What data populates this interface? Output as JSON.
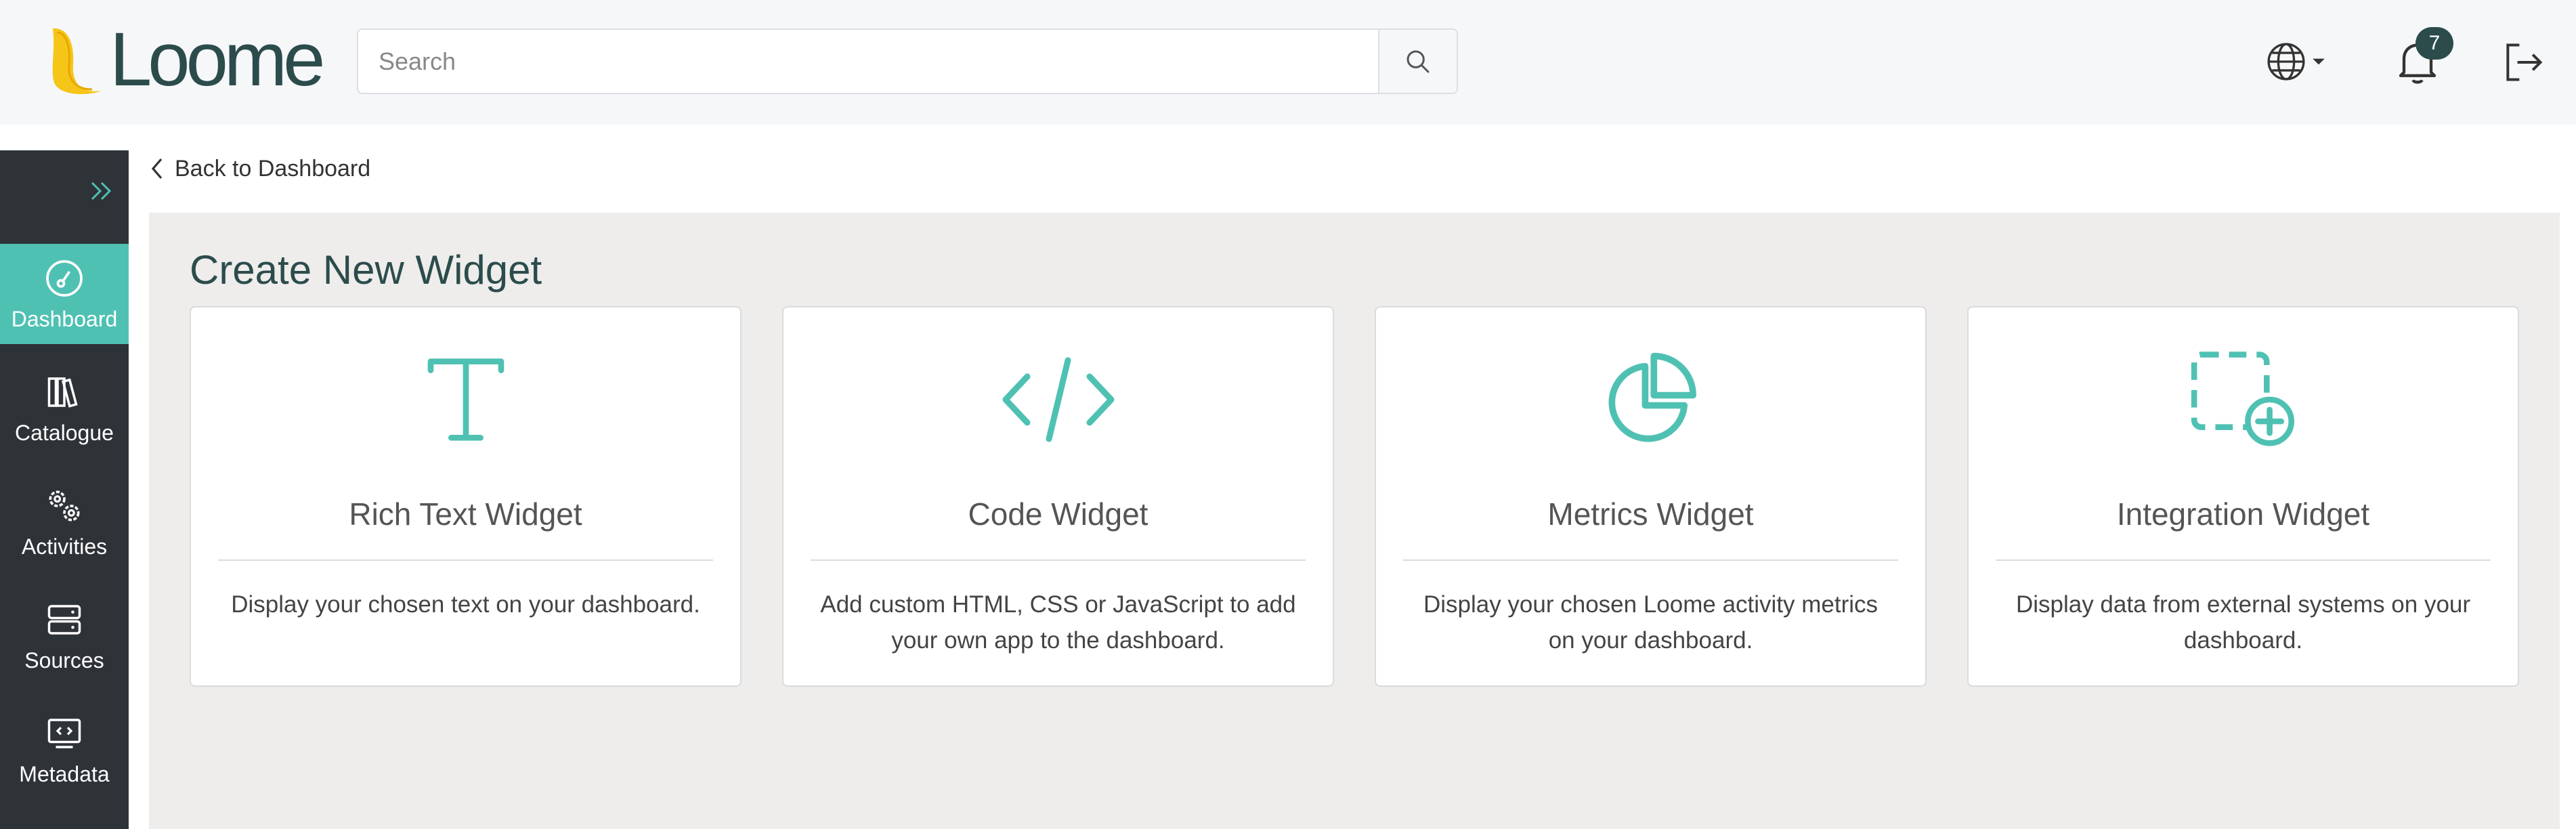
{
  "header": {
    "logo_text": "Loome",
    "search_placeholder": "Search",
    "notification_count": "7"
  },
  "sidebar": {
    "items": [
      {
        "label": "Dashboard",
        "icon": "dashboard-icon",
        "active": true
      },
      {
        "label": "Catalogue",
        "icon": "catalogue-icon",
        "active": false
      },
      {
        "label": "Activities",
        "icon": "activities-icon",
        "active": false
      },
      {
        "label": "Sources",
        "icon": "sources-icon",
        "active": false
      },
      {
        "label": "Metadata",
        "icon": "metadata-icon",
        "active": false
      }
    ]
  },
  "main": {
    "back_link": "Back to Dashboard",
    "title": "Create New Widget",
    "cards": [
      {
        "title": "Rich Text Widget",
        "description": "Display your chosen text on your dashboard.",
        "icon": "text-icon"
      },
      {
        "title": "Code Widget",
        "description": "Add custom HTML, CSS or JavaScript to add your own app to the dashboard.",
        "icon": "code-icon"
      },
      {
        "title": "Metrics Widget",
        "description": "Display your chosen Loome activity metrics on your dashboard.",
        "icon": "pie-chart-icon"
      },
      {
        "title": "Integration Widget",
        "description": "Display data from external systems on your dashboard.",
        "icon": "integration-add-icon"
      }
    ]
  },
  "colors": {
    "accent": "#4fc1b3",
    "brand_dark": "#2c4c4c",
    "sidebar_bg": "#2e3338",
    "panel_bg": "#eeedeb"
  }
}
